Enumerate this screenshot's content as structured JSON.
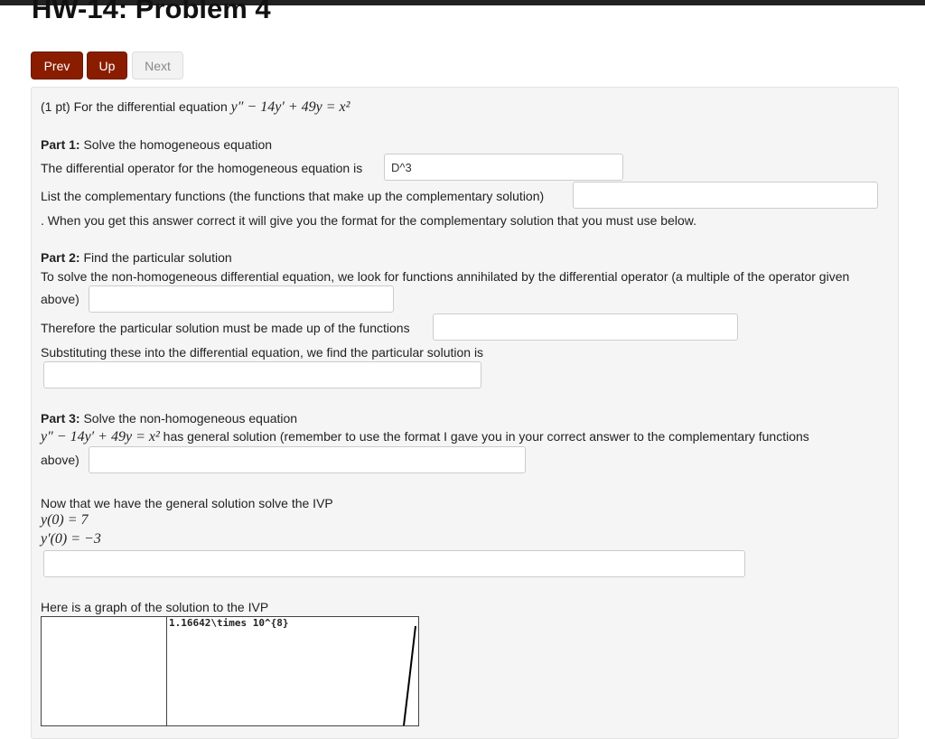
{
  "title": "HW-14: Problem 4",
  "nav": {
    "prev": "Prev",
    "up": "Up",
    "next": "Next"
  },
  "intro": "(1 pt) For the differential equation",
  "equation": "y″ − 14y′ + 49y = x²",
  "part1": {
    "label": "Part 1:",
    "heading": "Solve the homogeneous equation",
    "operator_text": "The differential operator for the homogeneous equation is",
    "operator_value": "D^3",
    "comp_text": "List the complementary functions (the functions that make up the complementary solution)",
    "comp_value": "",
    "note": ". When you get this answer correct it will give you the format for the complementary solution that you must use below."
  },
  "part2": {
    "label": "Part 2:",
    "heading": "Find the particular solution",
    "annihilator_text": "To solve the non-homogeneous differential equation, we look for functions annihilated by the differential operator (a multiple of the operator given",
    "annihilator_text2": "above)",
    "functions_text": "Therefore the particular solution must be made up of the functions",
    "subst_text": "Substituting these into the differential equation, we find the particular solution is"
  },
  "part3": {
    "label": "Part 3:",
    "heading": "Solve the non-homogeneous equation",
    "eq": "y″ − 14y′ + 49y = x²",
    "general_text": "has general solution (remember to use the format I gave you in your correct answer to the complementary functions",
    "general_text2": "above)"
  },
  "ivp": {
    "text": "Now that we have the general solution solve the IVP",
    "c1": "y(0) = 7",
    "c2": "y′(0) = −3"
  },
  "graph": {
    "caption": "Here is a graph of the solution to the IVP",
    "ymax_label": "1.16642\\times 10^{8}"
  }
}
